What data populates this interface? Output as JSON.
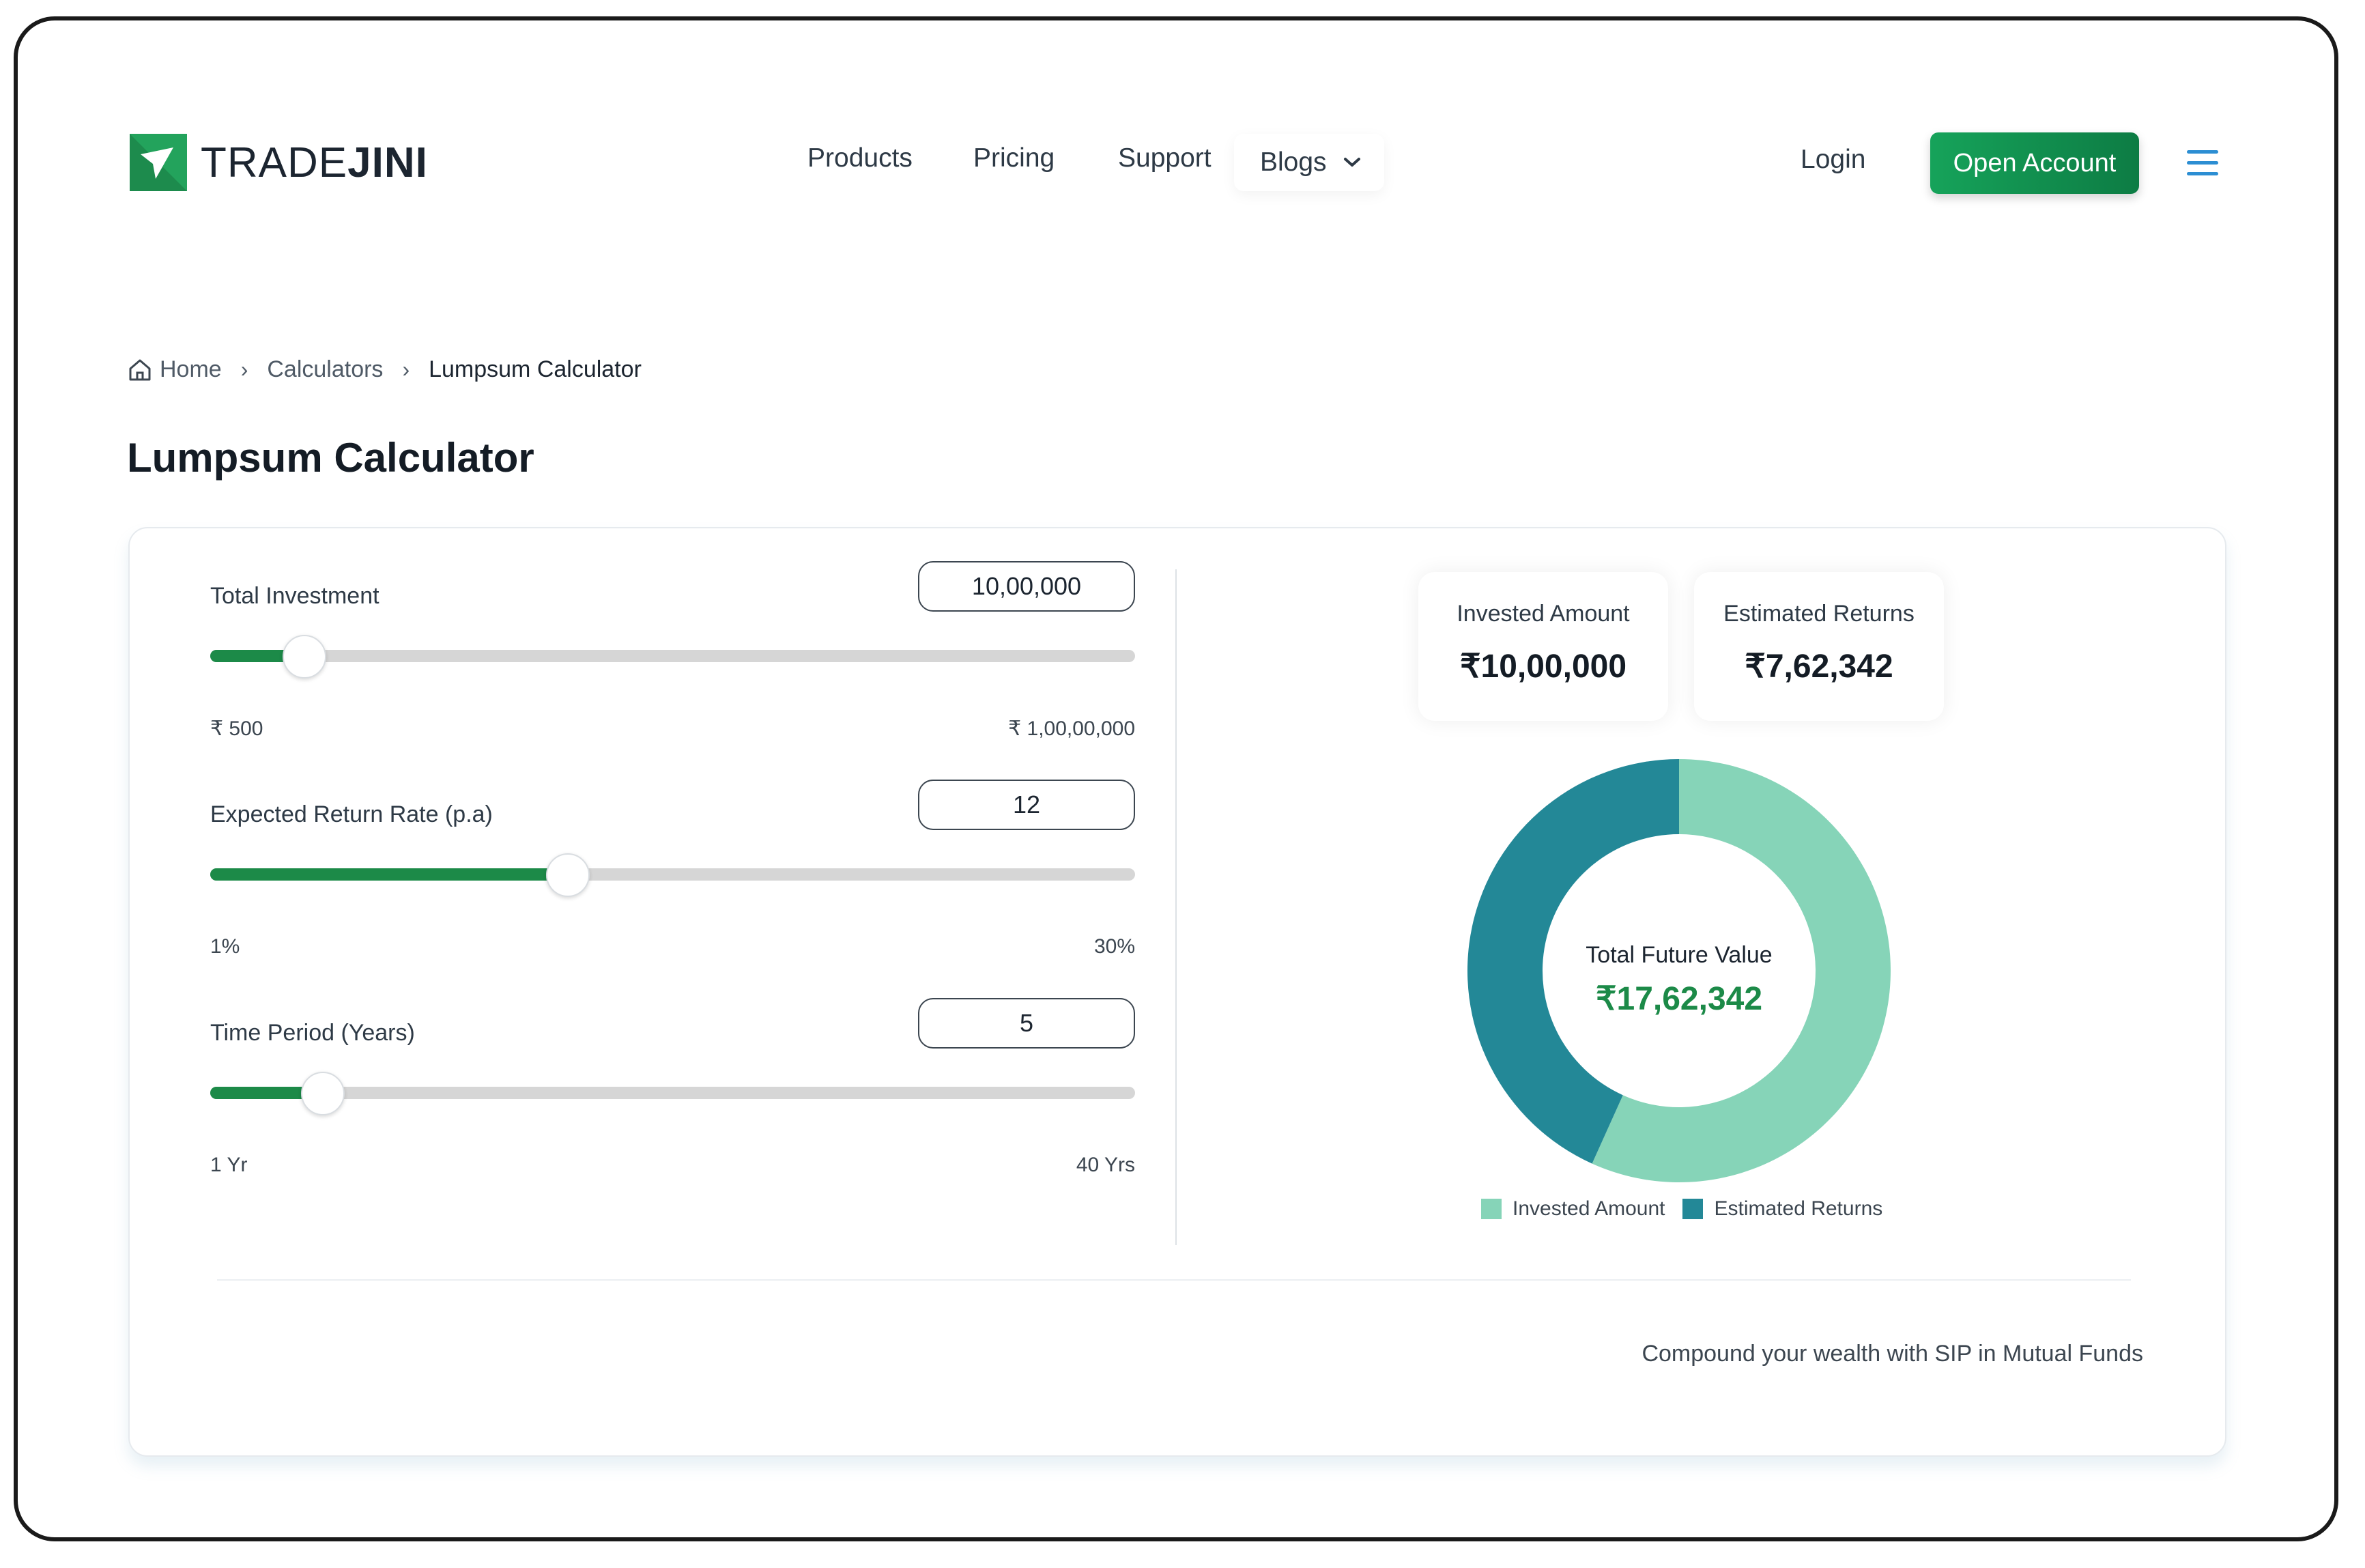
{
  "brand": {
    "name_light": "TRADE",
    "name_bold": "JINI"
  },
  "nav": {
    "items": [
      "Products",
      "Pricing",
      "Support"
    ],
    "blogs": "Blogs",
    "login": "Login",
    "open_account": "Open Account"
  },
  "breadcrumb": {
    "home": "Home",
    "calculators": "Calculators",
    "current": "Lumpsum Calculator",
    "separator": "›"
  },
  "page_title": "Lumpsum Calculator",
  "inputs": [
    {
      "label": "Total Investment",
      "value": "10,00,000",
      "min_label": "₹ 500",
      "max_label": "₹ 1,00,00,000",
      "fill_fraction": 0.1
    },
    {
      "label": "Expected Return Rate (p.a)",
      "value": "12",
      "min_label": "1%",
      "max_label": "30%",
      "fill_fraction": 0.385
    },
    {
      "label": "Time Period (Years)",
      "value": "5",
      "min_label": "1 Yr",
      "max_label": "40 Yrs",
      "fill_fraction": 0.12
    }
  ],
  "summary": {
    "invested_label": "Invested Amount",
    "invested_value": "₹10,00,000",
    "returns_label": "Estimated Returns",
    "returns_value": "₹7,62,342",
    "total_label": "Total Future Value",
    "total_value": "₹17,62,342"
  },
  "chart_data": {
    "type": "pie",
    "categories": [
      "Invested Amount",
      "Estimated Returns"
    ],
    "values": [
      1000000,
      762342
    ],
    "colors": [
      "#86d4b8",
      "#238897"
    ],
    "legend_position": "bottom"
  },
  "footer_link": "Compound your wealth with SIP in Mutual Funds",
  "colors": {
    "accent_green": "#1c8a48",
    "button_green": "#16a35a",
    "menu_blue": "#2c8ed3"
  },
  "icons": {
    "logo": "tradejini-logo-icon",
    "menu": "hamburger-menu-icon",
    "home": "home-icon",
    "chevron": "chevron-down-icon"
  }
}
